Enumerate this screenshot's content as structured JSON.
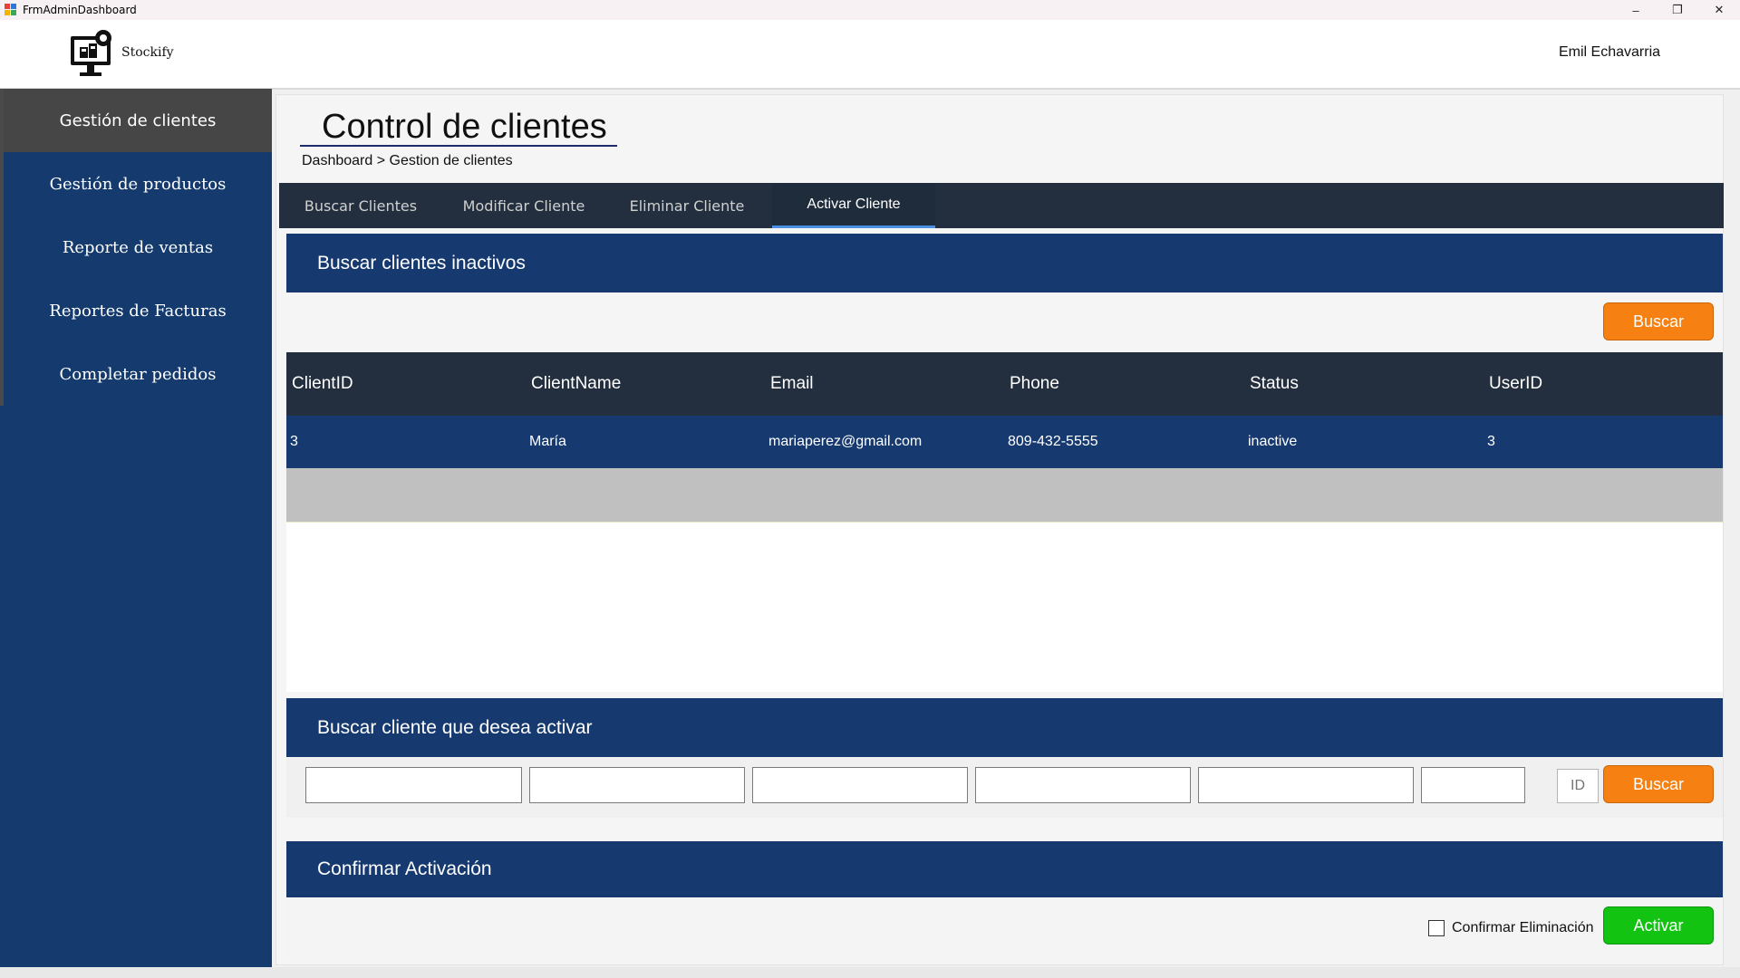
{
  "window": {
    "title": "FrmAdminDashboard",
    "controls": {
      "minimize": "–",
      "restore": "❐",
      "close": "✕"
    }
  },
  "header": {
    "brand": "Stockify",
    "user_name": "Emil Echavarria"
  },
  "sidebar": {
    "items": [
      {
        "label": "Gestión de clientes",
        "active": true
      },
      {
        "label": "Gestión de productos",
        "active": false
      },
      {
        "label": "Reporte de ventas",
        "active": false
      },
      {
        "label": "Reportes de Facturas",
        "active": false
      },
      {
        "label": "Completar pedidos",
        "active": false
      }
    ]
  },
  "main": {
    "title": "Control de clientes",
    "breadcrumb": "Dashboard > Gestion de clientes",
    "tabs": [
      {
        "label": "Buscar Clientes",
        "active": false
      },
      {
        "label": "Modificar Cliente",
        "active": false
      },
      {
        "label": "Eliminar Cliente",
        "active": false
      },
      {
        "label": "Activar Cliente",
        "active": true
      }
    ],
    "inactive_section": {
      "title": "Buscar clientes inactivos",
      "search_button": "Buscar"
    },
    "grid": {
      "columns": [
        "ClientID",
        "ClientName",
        "Email",
        "Phone",
        "Status",
        "UserID"
      ],
      "rows": [
        [
          "3",
          "María",
          "mariaperez@gmail.com",
          "809-432-5555",
          "inactive",
          "3"
        ]
      ]
    },
    "activate_section": {
      "title": "Buscar cliente que desea activar",
      "fields": [
        "",
        "",
        "",
        "",
        "",
        ""
      ],
      "id_placeholder": "ID",
      "search_button": "Buscar"
    },
    "confirm_section": {
      "title": "Confirmar Activación",
      "checkbox_label": "Confirmar Eliminación",
      "checkbox_checked": false,
      "activate_button": "Activar"
    }
  },
  "colors": {
    "sidebar": "#143a6e",
    "sidebar_active": "#464646",
    "tab_bar": "#232f3e",
    "section_bar": "#163a70",
    "orange_button": "#f78012",
    "green_button": "#12c312",
    "tab_indicator": "#4a90e2"
  }
}
